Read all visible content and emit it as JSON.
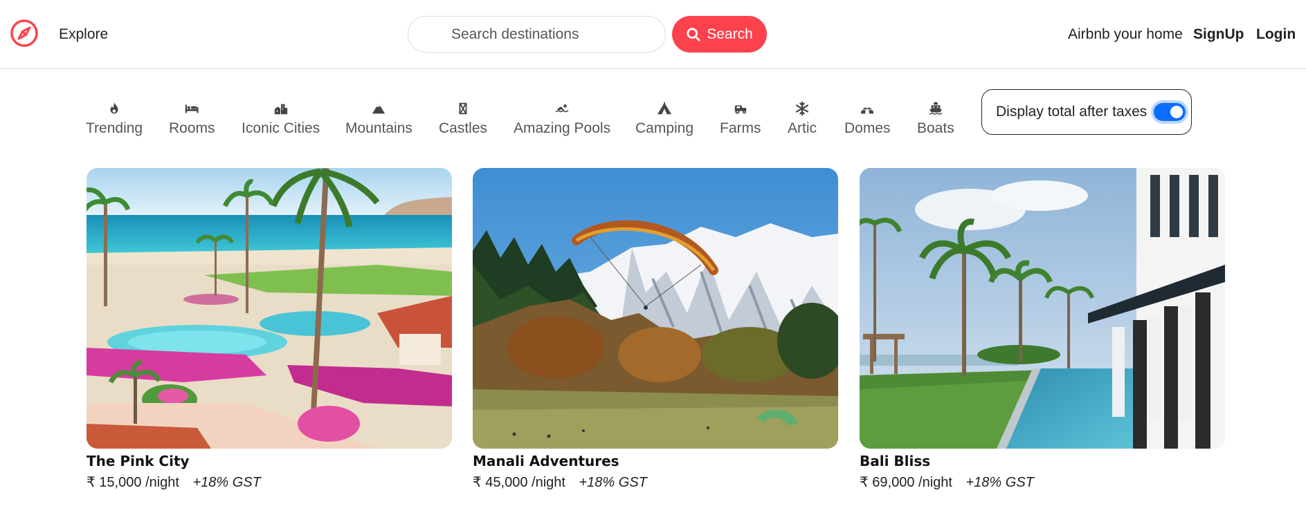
{
  "header": {
    "logo_icon": "compass-icon",
    "brand_color": "#fe424d",
    "explore_label": "Explore",
    "search_placeholder": "Search destinations",
    "search_button_label": "Search",
    "host_label": "Airbnb your home",
    "signup_label": "SignUp",
    "login_label": "Login"
  },
  "filters": [
    {
      "label": "Trending",
      "icon": "fire-icon"
    },
    {
      "label": "Rooms",
      "icon": "bed-icon"
    },
    {
      "label": "Iconic Cities",
      "icon": "city-icon"
    },
    {
      "label": "Mountains",
      "icon": "mountain-icon"
    },
    {
      "label": "Castles",
      "icon": "castle-icon"
    },
    {
      "label": "Amazing Pools",
      "icon": "swimmer-icon"
    },
    {
      "label": "Camping",
      "icon": "tent-icon"
    },
    {
      "label": "Farms",
      "icon": "tractor-icon"
    },
    {
      "label": "Artic",
      "icon": "snowflake-icon"
    },
    {
      "label": "Domes",
      "icon": "igloo-icon"
    },
    {
      "label": "Boats",
      "icon": "ship-icon"
    }
  ],
  "tax_toggle": {
    "label": "Display total after taxes",
    "enabled": true,
    "toggle_color": "#0d6efd"
  },
  "listings": [
    {
      "title": "The Pink City",
      "price": "₹ 15,000 /night",
      "tax": "+18% GST"
    },
    {
      "title": "Manali Adventures",
      "price": "₹ 45,000 /night",
      "tax": "+18% GST"
    },
    {
      "title": "Bali Bliss",
      "price": "₹ 69,000 /night",
      "tax": "+18% GST"
    }
  ]
}
